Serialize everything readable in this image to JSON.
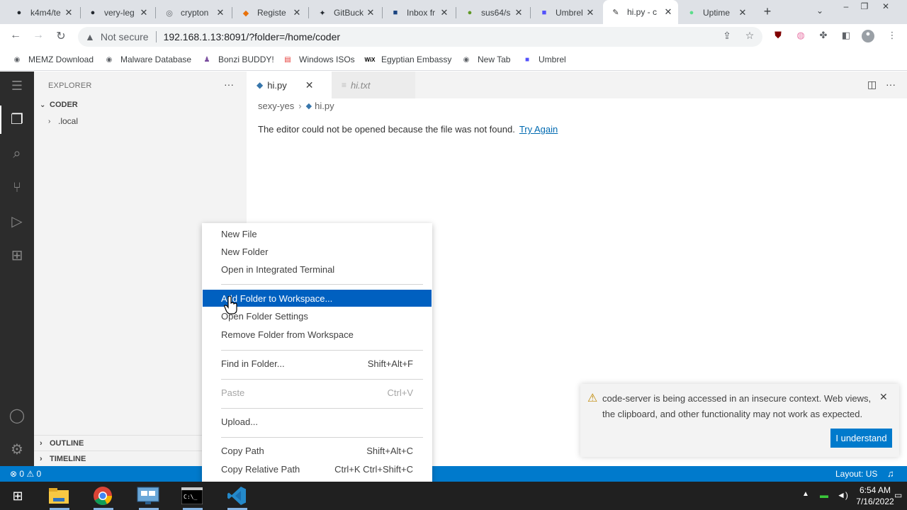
{
  "browser": {
    "tabs": [
      {
        "title": "k4m4/te",
        "icon": "github-icon",
        "color": "#24292f",
        "glyph": "●"
      },
      {
        "title": "very-leg",
        "icon": "github-icon",
        "color": "#24292f",
        "glyph": "●"
      },
      {
        "title": "crypton",
        "icon": "globe-icon",
        "color": "#5f6368",
        "glyph": "◎"
      },
      {
        "title": "Registe",
        "icon": "diamond-icon",
        "color": "#e8710a",
        "glyph": "◆"
      },
      {
        "title": "GitBuck",
        "icon": "gitbucket-icon",
        "color": "#24292f",
        "glyph": "✦"
      },
      {
        "title": "Inbox fr",
        "icon": "mail-icon",
        "color": "#1a4480",
        "glyph": "■"
      },
      {
        "title": "sus64/s",
        "icon": "gitea-icon",
        "color": "#609926",
        "glyph": "●"
      },
      {
        "title": "Umbrel",
        "icon": "umbrel-icon",
        "color": "#5351fb",
        "glyph": "■"
      },
      {
        "title": "hi.py - c",
        "icon": "code-server-icon",
        "color": "#333333",
        "glyph": "✎"
      },
      {
        "title": "Uptime",
        "icon": "uptime-icon",
        "color": "#5cdd8b",
        "glyph": "●"
      }
    ],
    "active_tab_index": 8,
    "security_label": "Not secure",
    "url": "192.168.1.13:8091/?folder=/home/coder",
    "bookmarks": [
      {
        "label": "MEMZ Download",
        "icon": "globe-icon"
      },
      {
        "label": "Malware Database",
        "icon": "globe-icon"
      },
      {
        "label": "Bonzi BUDDY!",
        "icon": "bonzi-icon"
      },
      {
        "label": "Windows ISOs",
        "icon": "rainbow-icon"
      },
      {
        "label": "Egyptian Embassy",
        "icon": "wix-icon"
      },
      {
        "label": "New Tab",
        "icon": "globe-icon"
      },
      {
        "label": "Umbrel",
        "icon": "umbrel-icon"
      }
    ],
    "wix_text": "WiX"
  },
  "explorer": {
    "title": "EXPLORER",
    "more": "···",
    "root": "CODER",
    "items": [
      ".local"
    ],
    "outline": "OUTLINE",
    "timeline": "TIMELINE"
  },
  "editor": {
    "tabs": [
      {
        "label": "hi.py",
        "state": "active"
      },
      {
        "label": "hi.txt",
        "state": "inactive"
      }
    ],
    "breadcrumbs": [
      "sexy-yes",
      "hi.py"
    ],
    "error_message": "The editor could not be opened because the file was not found.",
    "retry_link": "Try Again"
  },
  "context_menu": {
    "groups": [
      [
        {
          "label": "New File",
          "key": ""
        },
        {
          "label": "New Folder",
          "key": ""
        },
        {
          "label": "Open in Integrated Terminal",
          "key": ""
        }
      ],
      [
        {
          "label": "Add Folder to Workspace...",
          "key": "",
          "selected": true
        },
        {
          "label": "Open Folder Settings",
          "key": ""
        },
        {
          "label": "Remove Folder from Workspace",
          "key": ""
        }
      ],
      [
        {
          "label": "Find in Folder...",
          "key": "Shift+Alt+F"
        }
      ],
      [
        {
          "label": "Paste",
          "key": "Ctrl+V",
          "disabled": true
        }
      ],
      [
        {
          "label": "Upload...",
          "key": ""
        }
      ],
      [
        {
          "label": "Copy Path",
          "key": "Shift+Alt+C"
        },
        {
          "label": "Copy Relative Path",
          "key": "Ctrl+K Ctrl+Shift+C"
        }
      ]
    ]
  },
  "notification": {
    "message": "code-server is being accessed in an insecure context. Web views, the clipboard, and other functionality may not work as expected.",
    "button": "I understand"
  },
  "statusbar": {
    "problems": "⊗ 0 ⚠ 0",
    "layout": "Layout: US"
  },
  "taskbar": {
    "time": "6:54 AM",
    "date": "7/16/2022",
    "apps": [
      "file-explorer-icon",
      "chrome-icon",
      "network-icon",
      "terminal-icon",
      "vscode-icon"
    ]
  }
}
